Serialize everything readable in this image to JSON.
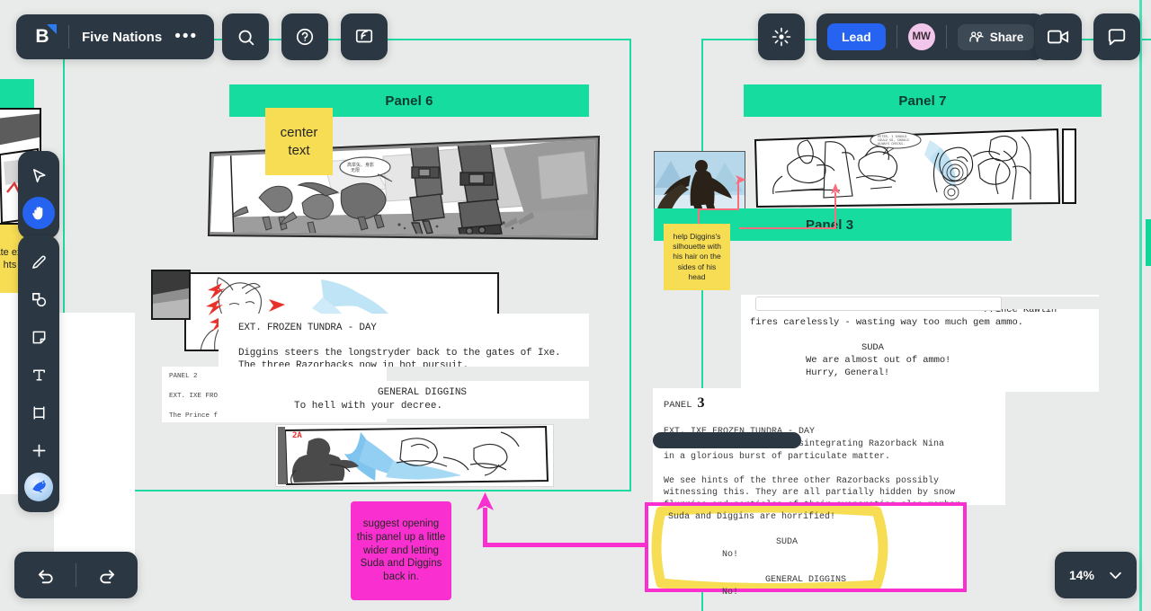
{
  "app": {
    "name": "Five Nations",
    "logo_letter": "B",
    "more_label": "•••"
  },
  "toolbar_top_left": {
    "items": [
      {
        "name": "search-icon",
        "label": "Search"
      },
      {
        "name": "help-icon",
        "label": "Help"
      },
      {
        "name": "present-icon",
        "label": "Present"
      }
    ]
  },
  "toolbar_top_right": {
    "magic_label": "Magic",
    "lead_label": "Lead",
    "avatar_initials": "MW",
    "share_label": "Share",
    "video_label": "Video call",
    "chat_label": "Chat"
  },
  "tool_rail": {
    "select_label": "Select",
    "hand_label": "Hand / Pan",
    "pen_label": "Pen",
    "shapes_label": "Shapes",
    "note_label": "Sticky note",
    "text_label": "Text",
    "frame_label": "Frame",
    "add_label": "Add more",
    "apps_label": "Apps"
  },
  "bottom_bar": {
    "undo_label": "Undo",
    "redo_label": "Redo",
    "zoom_level": "14%",
    "zoom_caret": "⌄"
  },
  "canvas": {
    "frames": [
      {
        "name": "frame-left"
      },
      {
        "name": "frame-right"
      }
    ],
    "panel_headers": [
      {
        "id": "panel6",
        "label": "Panel 6"
      },
      {
        "id": "panel7",
        "label": "Panel 7"
      },
      {
        "id": "panel3",
        "label": "Panel 3"
      }
    ],
    "sticky_notes": [
      {
        "id": "center-text",
        "color": "#f7dd54",
        "text": "center text"
      },
      {
        "id": "diggins-silhouette",
        "color": "#f7dd54",
        "text": "help Diggins's silhouette with his hair on the sides of his head"
      },
      {
        "id": "open-panel",
        "color": "#f930cf",
        "text": "suggest opening this panel up a little wider and letting Suda and Diggins back in."
      },
      {
        "id": "edge-note-clipped",
        "color": "#f7dd54",
        "text": "ate ext hts"
      }
    ],
    "documents": {
      "script_left_top": {
        "lines": [
          "EXT. FROZEN TUNDRA - DAY",
          "",
          "Diggins steers the longstryder back to the gates of Ixe.",
          "The three Razorbacks now in hot pursuit."
        ]
      },
      "script_left_panel2": {
        "lines": [
          "PANEL 2",
          "",
          "EXT. IXE FRO",
          "",
          "The Prince f"
        ]
      },
      "script_left_dialog": {
        "character": "GENERAL DIGGINS",
        "line": "To hell with your decree."
      },
      "script_right_top": {
        "lines": [
          "                                          Prince Kawlin",
          "fires carelessly - wasting way too much gem ammo.",
          "",
          "                    SUDA",
          "          We are almost out of ammo!",
          "          Hurry, General!"
        ]
      },
      "script_right_panel3": {
        "heading": "PANEL",
        "heading_number": "3",
        "slug": "EXT. IXE FROZEN TUNDRA - DAY",
        "lines": [
          "                       disintegrating Razorback Nina",
          "in a glorious burst of particulate matter.",
          "",
          "We see hints of the three other Razorbacks possibly",
          "witnessing this. They are all partially hidden by snow",
          "flurries and particles of their evaporating clan member."
        ]
      },
      "script_right_highlighted": {
        "lines": [
          "Suda and Diggins are horrified!",
          "",
          "                    SUDA",
          "          No!",
          "",
          "                  GENERAL DIGGINS",
          "          No!"
        ],
        "highlight_color": "#f7dd54",
        "outline_color": "#f930cf"
      }
    },
    "artwork": [
      {
        "id": "panel6-strip",
        "alt": "Storyboard strip: three razorback creatures charging past mech legs in a canyon"
      },
      {
        "id": "panel7-strip",
        "alt": "Line-art storyboard strip: riders on a longstryder near an ice crystal"
      },
      {
        "id": "diggins-ref",
        "alt": "Painted reference: Diggins silhouette with cape on an icy ridge"
      },
      {
        "id": "frozen-tundra-art",
        "alt": "Sketch: character with red arrow marks and blue ice burst"
      },
      {
        "id": "panel2a-art",
        "alt": "Sketch labelled 2A: characters on the longstryder with blue energy spray"
      },
      {
        "id": "thumb-left",
        "alt": "Small dark thumbnail of storyboard panel"
      }
    ]
  },
  "colors": {
    "canvas_bg": "#e9ebea",
    "frame_teal": "#1fd9a4",
    "header_teal": "#16dca0",
    "accent_blue": "#2563f0",
    "sticky_yellow": "#f7dd54",
    "sticky_pink": "#f930cf",
    "chrome_dark": "#2b3742",
    "connector_red": "#fa6d7d"
  }
}
